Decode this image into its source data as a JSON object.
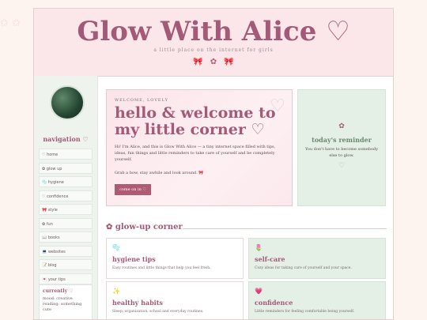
{
  "header": {
    "title": "Glow With Alice ♡",
    "subtitle": "a little place on the internet for girls",
    "bows": "🎀 ✿ 🎀"
  },
  "decor": {
    "stars": "✩ ✩"
  },
  "sidebar": {
    "nav_heading": "navigation ♡",
    "items": [
      {
        "label": "♡ home"
      },
      {
        "label": "✿ glow up"
      },
      {
        "label": "🫧 hygiene"
      },
      {
        "label": "♡ confidence"
      },
      {
        "label": "🎀 style"
      },
      {
        "label": "✿ fun"
      },
      {
        "label": "📖 books"
      },
      {
        "label": "💻 websites"
      },
      {
        "label": "📝 blog"
      },
      {
        "label": "💌 your tips"
      }
    ],
    "currently": {
      "title": "currently ♡",
      "mood": "mood: creative",
      "reading": "reading: something cute"
    }
  },
  "welcome": {
    "eyebrow": "WELCOME, LOVELY",
    "title": "hello & welcome to my little corner ♡",
    "heart": "♡",
    "text": "Hi! I'm Alice, and this is Glow With Alice — a tiny internet space filled with tips, ideas, fun things and little reminders to take care of yourself and be completely yourself.",
    "text2": "Grab a bow, stay awhile and look around. 🎀",
    "button": "come on in ♡"
  },
  "reminder": {
    "flower": "✿",
    "title": "today's reminder",
    "text": "You don't have to become somebody else to glow.",
    "heart": "♡"
  },
  "glow_corner": {
    "title": "✿ glow-up corner",
    "cards": [
      {
        "icon": "🫧",
        "title": "hygiene tips",
        "desc": "Easy routines and little things that help you feel fresh."
      },
      {
        "icon": "🌷",
        "title": "self-care",
        "desc": "Cozy ideas for taking care of yourself and your space."
      },
      {
        "icon": "✨",
        "title": "healthy habits",
        "desc": "Sleep, organization, school and everyday routines."
      },
      {
        "icon": "💗",
        "title": "confidence",
        "desc": "Little reminders for feeling comfortable being yourself."
      }
    ]
  }
}
